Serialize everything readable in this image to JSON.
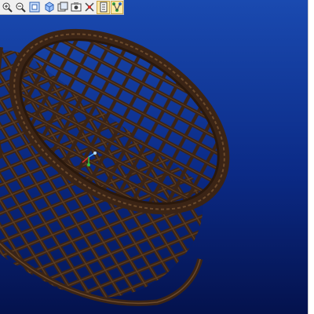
{
  "viewport": {
    "background_top": "#123a9e",
    "background_bottom": "#04114f",
    "basket_color": "#3b2415",
    "basket_highlight": "#6b4a2c"
  },
  "toolbar": {
    "buttons": [
      {
        "icon": "zoom-in-icon",
        "active": false
      },
      {
        "icon": "zoom-out-icon",
        "active": false
      },
      {
        "icon": "zoom-window-icon",
        "active": false
      },
      {
        "icon": "shading-cube-icon",
        "active": false
      },
      {
        "icon": "saved-views-icon",
        "active": false
      },
      {
        "icon": "repaint-icon",
        "active": false
      },
      {
        "icon": "datum-spin-icon",
        "active": false
      },
      {
        "icon": "orient-mode-icon",
        "active": true
      },
      {
        "icon": "tree-display-icon",
        "active": true
      }
    ]
  },
  "triad": {
    "x_color": "#e03030",
    "y_color": "#30c040",
    "z_color": "#4aa8ff"
  }
}
